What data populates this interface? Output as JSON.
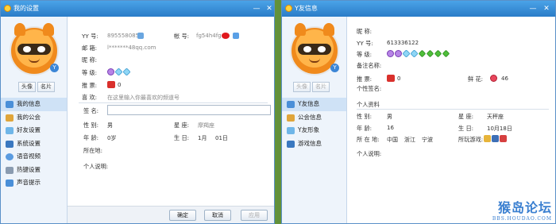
{
  "left_window": {
    "title": "我的设置",
    "window_controls": [
      "—",
      "✕"
    ],
    "tabs": [
      "头像",
      "名片"
    ],
    "nav": [
      {
        "label": "我的信息",
        "icon": "profile-card-icon",
        "active": true
      },
      {
        "label": "我的公会",
        "icon": "guild-icon",
        "active": false
      },
      {
        "label": "好友设置",
        "icon": "friend-settings-icon",
        "active": false
      },
      {
        "label": "系统设置",
        "icon": "system-settings-icon",
        "active": false
      },
      {
        "label": "语音视频",
        "icon": "voice-video-icon",
        "active": false
      },
      {
        "label": "热键设置",
        "icon": "hotkey-icon",
        "active": false
      },
      {
        "label": "声音提示",
        "icon": "sound-icon",
        "active": false
      }
    ],
    "fields": {
      "yy_label": "YY 号:",
      "yy_value": "895558085",
      "account_label": "帐 号:",
      "account_value": "fg54h4fg",
      "email_label": "邮 箱:",
      "email_value": "l*******48qq.com",
      "nickname_label": "昵 称:",
      "level_label": "等 级:",
      "recommend_label": "推 票:",
      "recommend_value": "0",
      "like_label": "喜 欢:",
      "like_placeholder": "在这里输入你最喜欢的频道号",
      "signature_label": "签 名:",
      "gender_label": "性 别:",
      "gender_value": "男",
      "zodiac_label": "星 座:",
      "zodiac_value": "摩羯座",
      "age_label": "年 龄:",
      "age_value": "0岁",
      "birthday_label": "生 日:",
      "birthday_month": "1月",
      "birthday_day": "01日",
      "location_label": "所在地:",
      "bio_label": "个人说明:"
    },
    "buttons": {
      "ok": "确定",
      "cancel": "取消",
      "apply": "应用"
    }
  },
  "right_window": {
    "title": "Y友信息",
    "window_controls": [
      "—",
      "✕"
    ],
    "tabs": [
      "头像",
      "名片"
    ],
    "nav": [
      {
        "label": "Y友信息",
        "icon": "friend-info-icon",
        "active": true
      },
      {
        "label": "公会信息",
        "icon": "guild-info-icon",
        "active": false
      },
      {
        "label": "Y友形象",
        "icon": "friend-avatar-icon",
        "active": false
      },
      {
        "label": "游戏信息",
        "icon": "game-info-icon",
        "active": false
      }
    ],
    "fields": {
      "nickname_label": "昵 称:",
      "yy_label": "YY 号:",
      "yy_value": "613336122",
      "level_label": "等 级:",
      "remark_label": "备注名称:",
      "recommend_label": "推 票:",
      "recommend_value": "0",
      "flowers_label": "鲜 花:",
      "flowers_value": "46",
      "group_label": "个性签名:",
      "profile_title": "个人资料",
      "gender_label": "性 别:",
      "gender_value": "男",
      "zodiac_label": "星 座:",
      "zodiac_value": "天秤座",
      "age_label": "年 龄:",
      "age_value": "16",
      "birthday_label": "生 日:",
      "birthday_value": "10月18日",
      "location_label": "所 在 地:",
      "location_country": "中国",
      "location_province": "浙江",
      "location_city": "宁波",
      "games_label": "所玩游戏:",
      "bio_label": "个人说明:"
    }
  },
  "watermark": {
    "main": "猴岛论坛",
    "sub": "BBS.HOUDAO.COM"
  },
  "colors": {
    "titlebar": "#2a7cc7",
    "nav_active": "#cfe2f6",
    "red_badge": "#d9302c"
  }
}
